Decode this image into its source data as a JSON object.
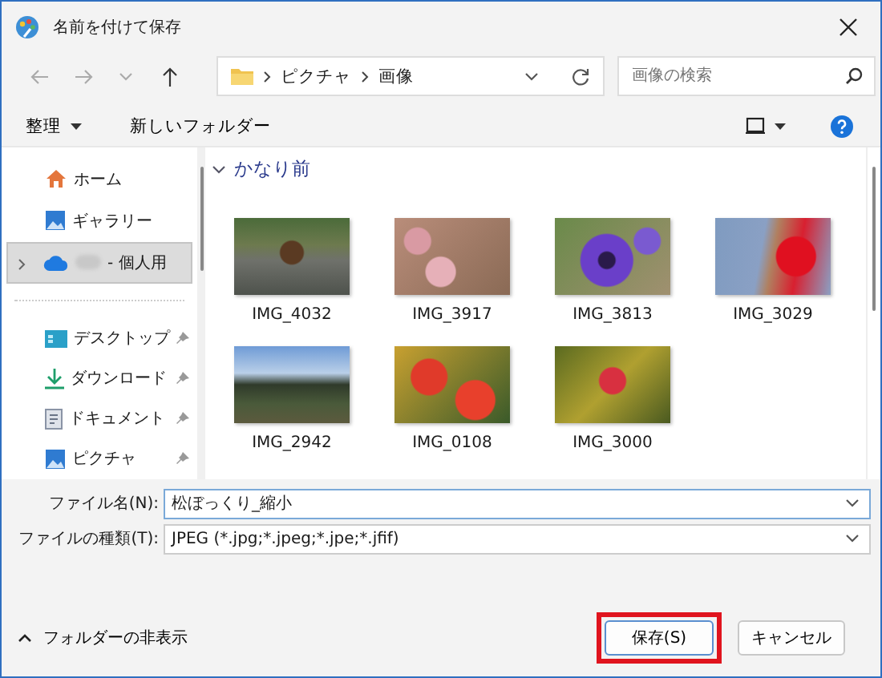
{
  "window": {
    "title": "名前を付けて保存"
  },
  "address": {
    "path": [
      "ピクチャ",
      "画像"
    ]
  },
  "search": {
    "placeholder": "画像の検索"
  },
  "toolbar": {
    "organize": "整理",
    "new_folder": "新しいフォルダー"
  },
  "sidebar": {
    "top_items": [
      {
        "label": "ホーム",
        "kind": "home",
        "selected": false,
        "expandable": false
      },
      {
        "label": "ギャラリー",
        "kind": "gallery",
        "selected": false,
        "expandable": false
      },
      {
        "label": "- 個人用",
        "kind": "cloud",
        "selected": true,
        "expandable": true
      }
    ],
    "quick_access": [
      {
        "label": "デスクトップ",
        "kind": "desktop",
        "pinned": true
      },
      {
        "label": "ダウンロード",
        "kind": "download",
        "pinned": true
      },
      {
        "label": "ドキュメント",
        "kind": "document",
        "pinned": true
      },
      {
        "label": "ピクチャ",
        "kind": "pictures",
        "pinned": true
      }
    ]
  },
  "group": {
    "label": "かなり前",
    "expanded": true
  },
  "files": [
    {
      "name": "IMG_4032",
      "kind": "pinecone"
    },
    {
      "name": "IMG_3917",
      "kind": "blossom"
    },
    {
      "name": "IMG_3813",
      "kind": "pansy"
    },
    {
      "name": "IMG_3029",
      "kind": "maple"
    },
    {
      "name": "IMG_2942",
      "kind": "mountain"
    },
    {
      "name": "IMG_0108",
      "kind": "dahlia"
    },
    {
      "name": "IMG_3000",
      "kind": "berries"
    }
  ],
  "file_name": {
    "label": "ファイル名(N):",
    "value": "松ぼっくり_縮小"
  },
  "file_type": {
    "label": "ファイルの種類(T):",
    "value": "JPEG (*.jpg;*.jpeg;*.jpe;*.jfif)"
  },
  "footer": {
    "hide_folders": "フォルダーの非表示",
    "buttons": [
      {
        "label": "保存(S)",
        "kind": "primary",
        "highlighted": true
      },
      {
        "label": "キャンセル",
        "kind": "secondary",
        "highlighted": false
      }
    ]
  }
}
